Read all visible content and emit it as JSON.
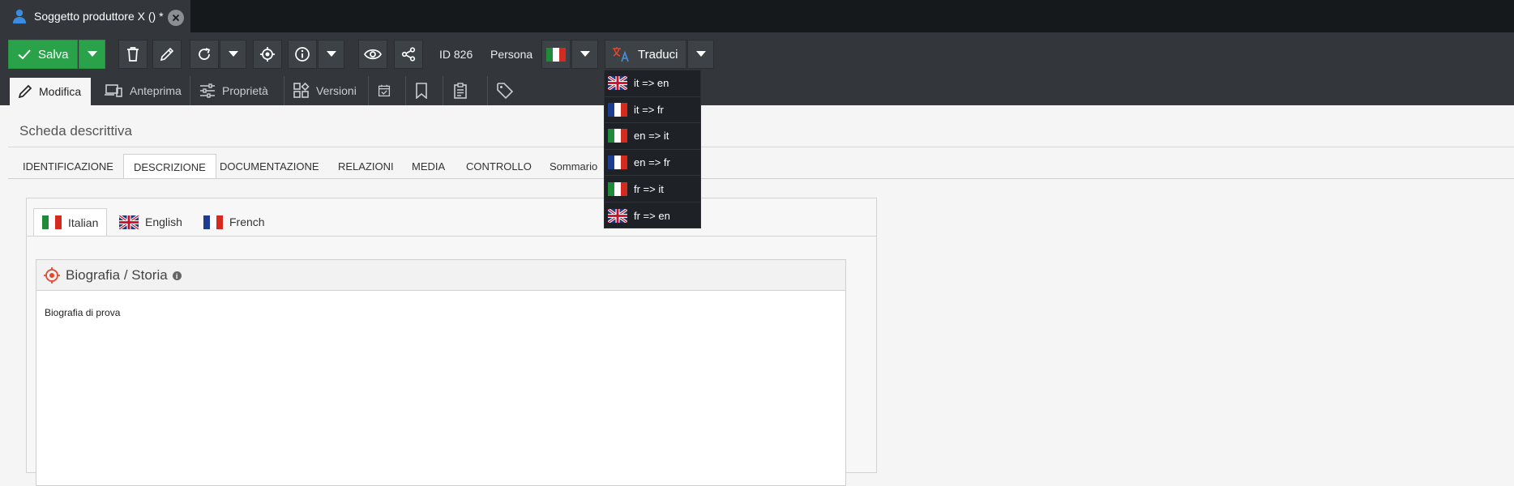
{
  "doc_tab": {
    "title": "Soggetto produttore X () *",
    "icon": "user-icon"
  },
  "toolbar": {
    "save_label": "Salva",
    "id_label": "ID 826",
    "type_label": "Persona",
    "translate_label": "Traduci"
  },
  "view_tabs": [
    {
      "label": "Modifica",
      "icon": "pencil-icon"
    },
    {
      "label": "Anteprima",
      "icon": "devices-icon"
    },
    {
      "label": "Proprietà",
      "icon": "sliders-icon"
    },
    {
      "label": "Versioni",
      "icon": "versions-icon"
    }
  ],
  "content": {
    "title": "Scheda descrittiva"
  },
  "section_tabs": [
    "IDENTIFICAZIONE",
    "DESCRIZIONE",
    "DOCUMENTAZIONE",
    "RELAZIONI",
    "MEDIA",
    "CONTROLLO",
    "Sommario"
  ],
  "lang_tabs": [
    {
      "label": "Italian",
      "flag": "it"
    },
    {
      "label": "English",
      "flag": "uk"
    },
    {
      "label": "French",
      "flag": "fr"
    }
  ],
  "field": {
    "label": "Biografia / Storia",
    "info": "i",
    "value": "Biografia di prova"
  },
  "translate_menu": [
    {
      "label": "it => en",
      "flag": "uk"
    },
    {
      "label": "it => fr",
      "flag": "fr"
    },
    {
      "label": "en => it",
      "flag": "it"
    },
    {
      "label": "en => fr",
      "flag": "fr"
    },
    {
      "label": "fr => it",
      "flag": "it"
    },
    {
      "label": "fr => en",
      "flag": "uk"
    }
  ],
  "colors": {
    "save_green": "#2aa24a",
    "toolbar_bg": "#33373b",
    "tabstrip_bg": "#16191c",
    "accent_red": "#e5462d",
    "user_blue": "#3b8be0"
  }
}
